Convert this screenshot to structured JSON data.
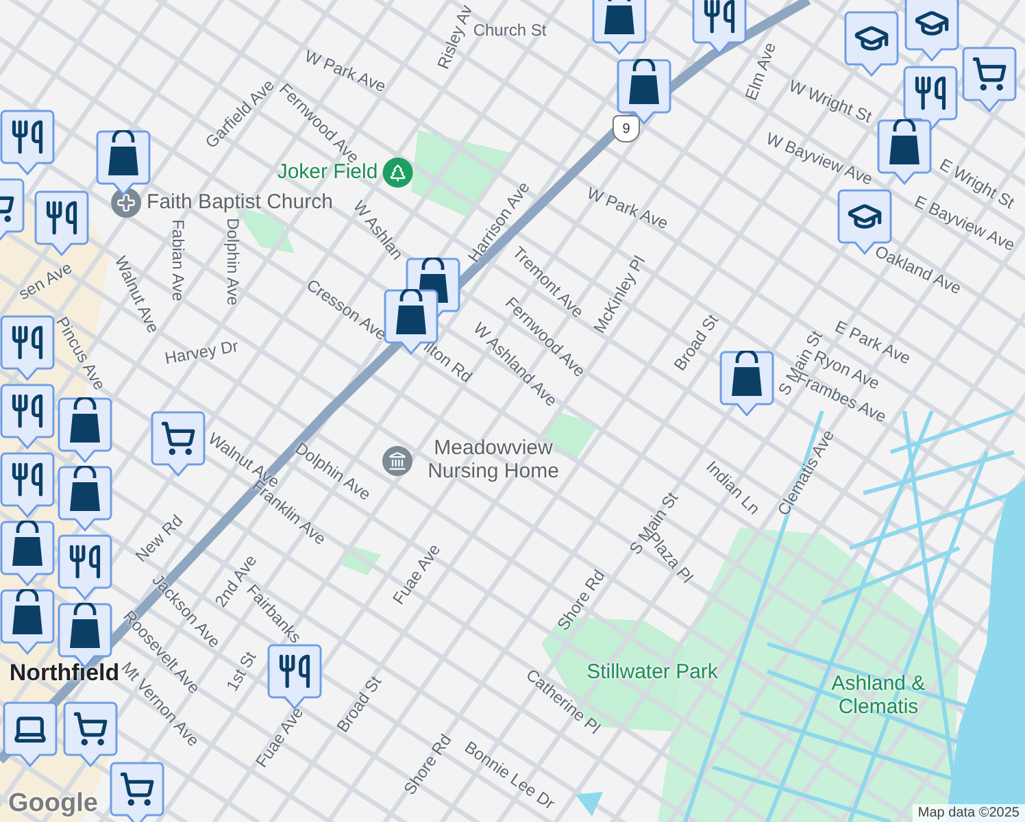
{
  "map": {
    "streets": [
      {
        "label": "Church St"
      },
      {
        "label": "Risley Av"
      },
      {
        "label": "W Park Ave"
      },
      {
        "label": "Garfield Ave"
      },
      {
        "label": "Fernwood Ave"
      },
      {
        "label": "Harrison Ave"
      },
      {
        "label": "W Ashlan"
      },
      {
        "label": "Cresson Ave"
      },
      {
        "label": "ilton Rd"
      },
      {
        "label": "Fabian Ave"
      },
      {
        "label": "Dolphin Ave"
      },
      {
        "label": "Walnut Ave"
      },
      {
        "label": "Harvey Dr"
      },
      {
        "label": "Pincus Ave"
      },
      {
        "label": "sen Ave"
      },
      {
        "label": "Tremont Ave"
      },
      {
        "label": "McKinley Pl"
      },
      {
        "label": "Fernwood Ave"
      },
      {
        "label": "W Ashland Ave"
      },
      {
        "label": "W Park Ave"
      },
      {
        "label": "Elm Ave"
      },
      {
        "label": "W Wright St"
      },
      {
        "label": "W Bayview Ave"
      },
      {
        "label": "E Wright St"
      },
      {
        "label": "E Bayview Ave"
      },
      {
        "label": "Oakland Ave"
      },
      {
        "label": "E Park Ave"
      },
      {
        "label": "Ryon Ave"
      },
      {
        "label": "Frambes Ave"
      },
      {
        "label": "Broad St"
      },
      {
        "label": "S Main St"
      },
      {
        "label": "S Main St"
      },
      {
        "label": "Shore Rd"
      },
      {
        "label": "Plaza Pl"
      },
      {
        "label": "Indian Ln"
      },
      {
        "label": "Clematis Ave"
      },
      {
        "label": "Walnut Ave"
      },
      {
        "label": "Dolphin Ave"
      },
      {
        "label": "Franklin Ave"
      },
      {
        "label": "New Rd"
      },
      {
        "label": "Jackson Ave"
      },
      {
        "label": "2nd Ave"
      },
      {
        "label": "Fairbanks"
      },
      {
        "label": "Roosevelt Ave"
      },
      {
        "label": "1st St"
      },
      {
        "label": "Mt Vernon Ave"
      },
      {
        "label": "Fuae Ave"
      },
      {
        "label": "Fuae Ave"
      },
      {
        "label": "Broad St"
      },
      {
        "label": "Shore Rd"
      },
      {
        "label": "Catherine Pl"
      },
      {
        "label": "Bonnie Lee Dr"
      }
    ],
    "places": [
      {
        "kind": "park_poi",
        "label": "Joker Field"
      },
      {
        "kind": "worship",
        "label": "Faith Baptist Church"
      },
      {
        "kind": "care",
        "label": "Meadowview Nursing Home"
      },
      {
        "kind": "park",
        "label": "Stillwater Park"
      },
      {
        "kind": "park",
        "label": "Ashland & Clematis"
      },
      {
        "kind": "town",
        "label": "Northfield"
      }
    ],
    "route_shield": "9",
    "markers": [
      {
        "kind": "shopping"
      },
      {
        "kind": "restaurant"
      },
      {
        "kind": "school"
      },
      {
        "kind": "school"
      },
      {
        "kind": "grocery"
      },
      {
        "kind": "restaurant"
      },
      {
        "kind": "shopping"
      },
      {
        "kind": "school"
      },
      {
        "kind": "shopping"
      },
      {
        "kind": "shopping"
      },
      {
        "kind": "shopping"
      },
      {
        "kind": "shopping"
      },
      {
        "kind": "restaurant"
      },
      {
        "kind": "grocery"
      },
      {
        "kind": "restaurant"
      },
      {
        "kind": "restaurant"
      },
      {
        "kind": "restaurant"
      },
      {
        "kind": "shopping"
      },
      {
        "kind": "shopping"
      },
      {
        "kind": "shopping"
      },
      {
        "kind": "shopping"
      },
      {
        "kind": "restaurant"
      },
      {
        "kind": "shopping"
      },
      {
        "kind": "shopping"
      },
      {
        "kind": "restaurant"
      },
      {
        "kind": "grocery"
      },
      {
        "kind": "restaurant"
      },
      {
        "kind": "laptop"
      },
      {
        "kind": "grocery"
      },
      {
        "kind": "grocery"
      }
    ],
    "attribution": {
      "logo": "Google",
      "text": "Map data ©2025"
    }
  }
}
